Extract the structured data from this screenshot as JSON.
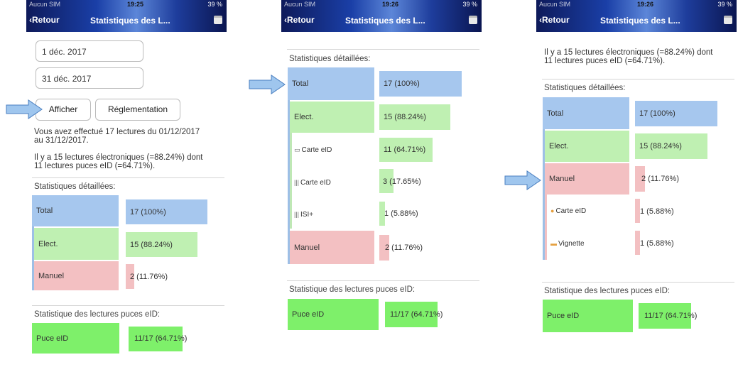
{
  "status": {
    "carrier": "Aucun SIM",
    "battery1": "39 %",
    "time1": "19:25",
    "time2": "19:26",
    "time3": "19:26",
    "battery2": "39 %",
    "battery3": "39 %"
  },
  "nav": {
    "back": "Retour",
    "title": "Statistiques des L..."
  },
  "screen1": {
    "date_from": "1 déc. 2017",
    "date_to": "31 déc. 2017",
    "btn_show": "Afficher",
    "btn_rules": "Réglementation",
    "para1_line1": "Vous avez effectué 17 lectures du 01/12/2017",
    "para1_line2": "au 31/12/2017.",
    "para2_line1": "Il y a 15 lectures électroniques (=88.24%) dont",
    "para2_line2": "11 lectures puces eID (=64.71%).",
    "section_detail": "Statistiques détaillées:",
    "rows": [
      {
        "label": "Total",
        "value": "17 (100%)"
      },
      {
        "label": "Elect.",
        "value": "15 (88.24%)"
      },
      {
        "label": "Manuel",
        "value": "2 (11.76%)"
      }
    ],
    "section_eid": "Statistique des lectures puces eID:",
    "eid": {
      "label": "Puce eID",
      "value": "11/17 (64.71%)"
    }
  },
  "screen2": {
    "section_detail": "Statistiques détaillées:",
    "total": {
      "label": "Total",
      "value": "17 (100%)"
    },
    "elect": {
      "label": "Elect.",
      "value": "15 (88.24%)"
    },
    "subs": [
      {
        "label": "Carte eID",
        "value": "11 (64.71%)",
        "icon": "card-icon"
      },
      {
        "label": "Carte eID",
        "value": "3 (17.65%)",
        "icon": "barcode-icon"
      },
      {
        "label": "ISI+",
        "value": "1 (5.88%)",
        "icon": "barcode-icon"
      }
    ],
    "manuel": {
      "label": "Manuel",
      "value": "2 (11.76%)"
    },
    "section_eid": "Statistique des lectures puces eID:",
    "eid": {
      "label": "Puce eID",
      "value": "11/17 (64.71%)"
    }
  },
  "screen3": {
    "para_line1": "Il y a 15 lectures électroniques (=88.24%) dont",
    "para_line2": "11 lectures puces eID (=64.71%).",
    "section_detail": "Statistiques détaillées:",
    "total": {
      "label": "Total",
      "value": "17 (100%)"
    },
    "elect": {
      "label": "Elect.",
      "value": "15 (88.24%)"
    },
    "manuel": {
      "label": "Manuel",
      "value": "2 (11.76%)"
    },
    "subs": [
      {
        "label": "Carte eID",
        "value": "1 (5.88%)",
        "icon": "hand-icon"
      },
      {
        "label": "Vignette",
        "value": "1 (5.88%)",
        "icon": "sticker-icon"
      }
    ],
    "section_eid": "Statistique des lectures puces eID:",
    "eid": {
      "label": "Puce eID",
      "value": "11/17 (64.71%)"
    }
  },
  "colors": {
    "total": "#a6c7ee",
    "elect": "#bff0b2",
    "manuel": "#f3c0c2",
    "eid": "#7ef06a",
    "arrow": "#9fc6ee"
  }
}
